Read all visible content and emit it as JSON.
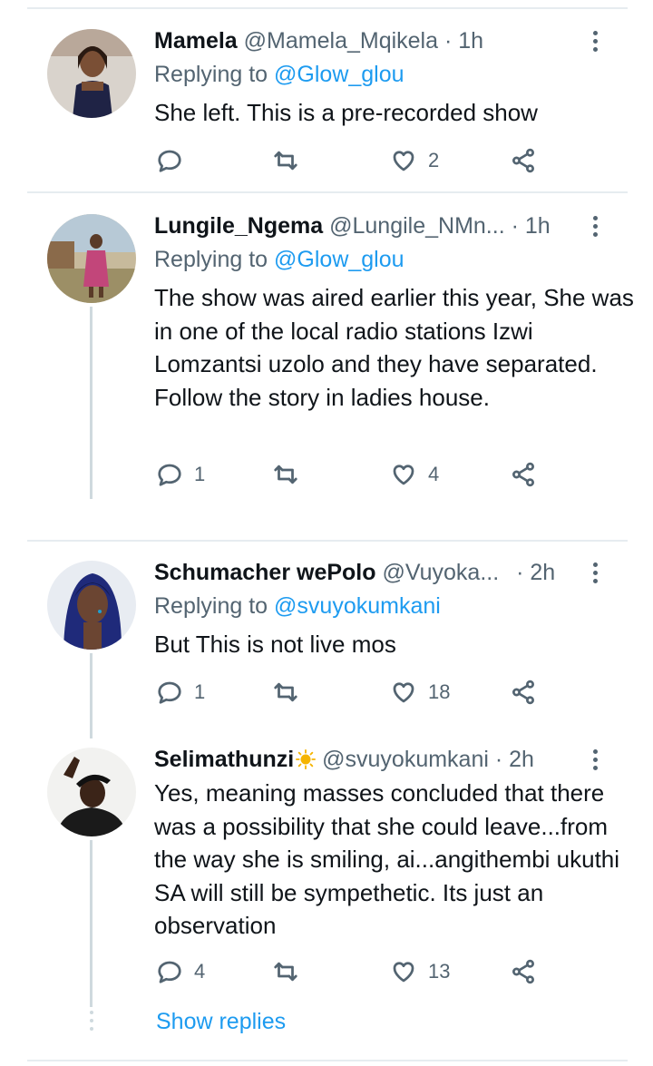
{
  "tweets": [
    {
      "name": "Mamela",
      "handle": "@Mamela_Mqikela",
      "time": "· 1h",
      "replying_prefix": "Replying to ",
      "replying_to": "@Glow_glou",
      "text": "She left. This is a pre-recorded show",
      "replies": "",
      "retweets": "",
      "likes": "2"
    },
    {
      "name": "Lungile_Ngema",
      "handle": "@Lungile_NMn...",
      "time": "· 1h",
      "replying_prefix": "Replying to ",
      "replying_to": "@Glow_glou",
      "text": "The show was aired earlier this year, She was in one of the local radio stations Izwi Lomzantsi uzolo and they have separated. Follow the story in ladies house.",
      "replies": "1",
      "retweets": "",
      "likes": "4"
    },
    {
      "name": "Schumacher wePolo",
      "handle": "@Vuyoka...",
      "time": "· 2h",
      "replying_prefix": "Replying to ",
      "replying_to": "@svuyokumkani",
      "text": "But This is not live mos",
      "replies": "1",
      "retweets": "",
      "likes": "18"
    },
    {
      "name": "Selimathunzi",
      "handle": "@svuyokumkani",
      "time": "· 2h",
      "text": "Yes, meaning masses concluded that there was a possibility that she could leave...from the way she is smiling, ai...angithembi ukuthi SA will still be sympethetic. Its just an observation",
      "replies": "4",
      "retweets": "",
      "likes": "13"
    }
  ],
  "show_replies": "Show replies",
  "icons": [
    "reply-icon",
    "retweet-icon",
    "like-icon",
    "share-icon",
    "more-icon",
    "sun-emoji-icon"
  ],
  "colors": {
    "accent": "#1d9bf0",
    "secondary_text": "#536471",
    "divider": "#e6ecf0"
  }
}
